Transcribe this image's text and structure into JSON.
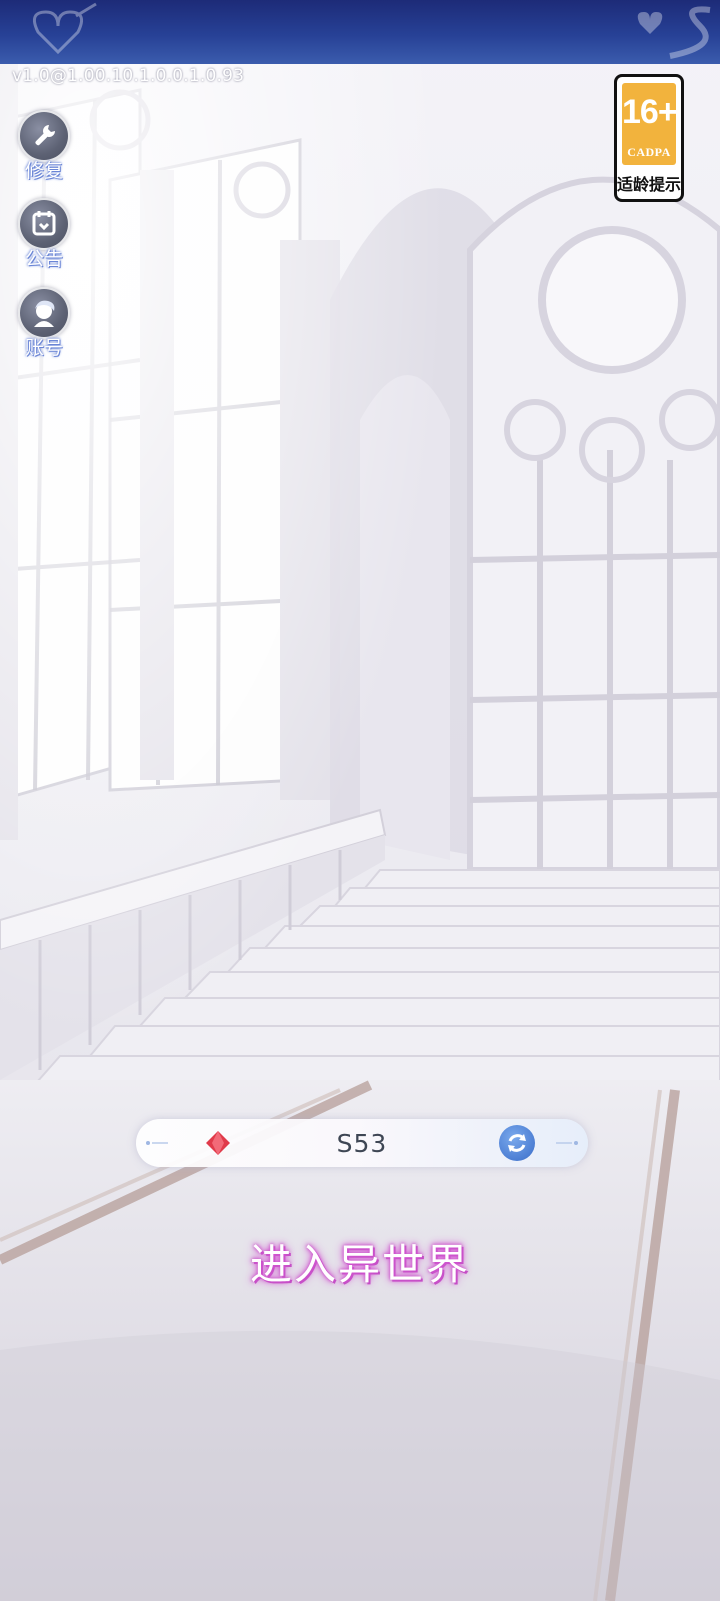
{
  "version": "v1.0@1.00.10.1.0.0.1.0.93",
  "side_buttons": [
    {
      "label": "修复",
      "icon": "wrench-icon"
    },
    {
      "label": "公告",
      "icon": "notice-icon"
    },
    {
      "label": "账号",
      "icon": "avatar-icon"
    }
  ],
  "age_badge": {
    "age": "16+",
    "org": "CADPA",
    "tip": "适龄提示"
  },
  "server": {
    "name": "S53"
  },
  "enter_button": {
    "label": "进入异世界"
  },
  "colors": {
    "banner": "#274196",
    "badge_orange": "#f2b33d",
    "refresh_blue": "#4d7fd4",
    "gem_red": "#e03a4a",
    "enter_glow": "#d55bd4"
  }
}
